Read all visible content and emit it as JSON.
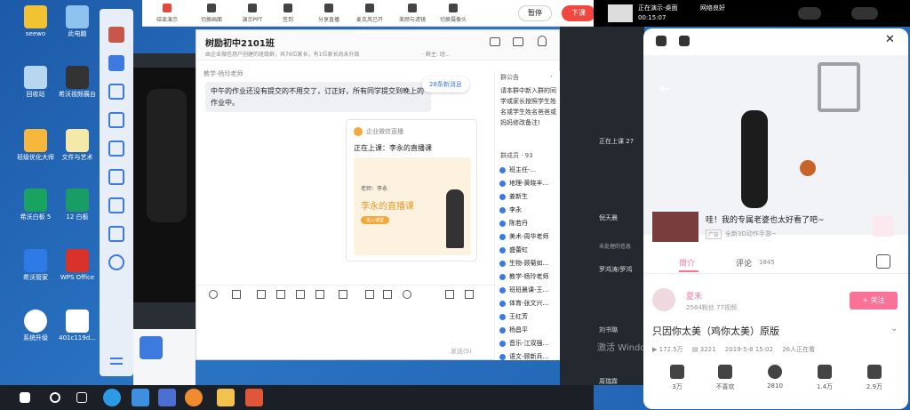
{
  "top_toolbar": {
    "items": [
      "结束演示",
      "切换画面",
      "演示PPT",
      "签到",
      "分享直播",
      "麦克风已开",
      "美颜与滤镜",
      "切换摄像头"
    ],
    "pause": "暂停",
    "end": "下课",
    "live_status": "正在演示-桌面",
    "live_time": "00:15:07",
    "network": "网络良好"
  },
  "desktop": {
    "icons": [
      "seewo",
      "此电脑",
      "回收站",
      "希沃视频展台",
      "班级优化大师",
      "文件与艺术",
      "希沃白板 5",
      "12 白板",
      "希沃管家",
      "WPS Office",
      "系统升级",
      "401c119d..."
    ]
  },
  "chat": {
    "title": "树励初中2101班",
    "subtitle": "由企业微信用户创建的班级群，共76位家长，有1位家长尚未升级",
    "owner": "· 群主: 班...",
    "sender": "教学-杨玲老师",
    "message": "中午的作业还没有提交的不用交了，订正好，所有同学提交到晚上的作业中。",
    "new_msgs": "28条新消息",
    "card_source": "企业微信直播",
    "card_title": "正在上课：李永的直播课",
    "card_teacher": "老师：李永",
    "card_course": "李永的直播课",
    "card_button": "进入课堂",
    "send": "发送(S)",
    "notice_title": "群公告",
    "notice_text": "请本群中新入群的同学或家长按照学生姓名或学生姓名爸爸或妈妈修改备注!",
    "members_title": "群成员 · 93",
    "members": [
      "班主任-...",
      "地理-黄晓丰...",
      "姜新生",
      "李永",
      "陈若丹",
      "美术-周华老师",
      "盛蕾虹",
      "生物-顾菊如...",
      "教学-杨玲老师",
      "班班晨课-王...",
      "体育-张文兴...",
      "王红芳",
      "杨昌平",
      "音乐-江双强...",
      "语文-顾新兵..."
    ]
  },
  "behind": {
    "live_count": "正在上课 27",
    "user1": "倪天晨",
    "user2": "罗鸿涛/罗鸿",
    "text1": "未处理的信息",
    "user3": "刘书璐",
    "user4": "周瑞霖",
    "watermark": "激活 Windows"
  },
  "phone": {
    "ad_title": "哇！我的专属老婆也太好看了吧~",
    "ad_badge": "广告",
    "ad_sub": "全新3D动作手游~",
    "tab_intro": "简介",
    "tab_comments": "评论",
    "comment_count": "1845",
    "up_name": "夏禾",
    "up_stats": "2584粉丝   77视频",
    "follow": "+ 关注",
    "video_title": "只因你太美（鸡你太美）原版",
    "views": "172.5万",
    "danmaku": "3221",
    "date": "2019-5-8 15:02",
    "watching": "26人正在看",
    "actions": [
      {
        "label": "3万"
      },
      {
        "label": "不喜欢"
      },
      {
        "label": "2810"
      },
      {
        "label": "1.4万"
      },
      {
        "label": "2.9万"
      }
    ]
  }
}
